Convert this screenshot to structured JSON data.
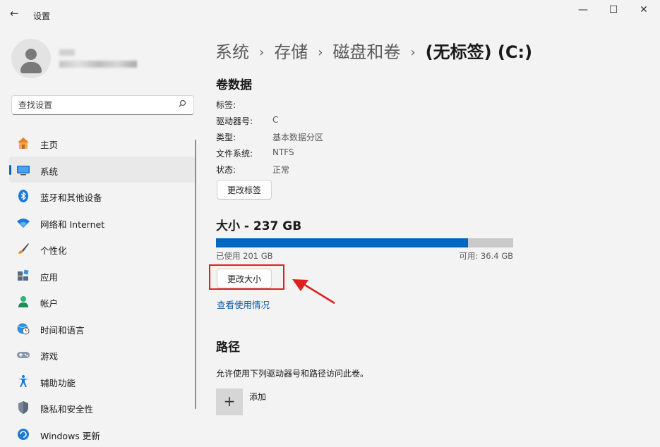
{
  "window": {
    "title": "设置",
    "back_glyph": "←",
    "minimize_glyph": "—",
    "maximize_glyph": "☐",
    "close_glyph": "✕"
  },
  "search": {
    "placeholder": "查找设置",
    "value": "",
    "icon": "search-icon"
  },
  "sidebar": {
    "items": [
      {
        "label": "主页",
        "icon": "home-icon"
      },
      {
        "label": "系统",
        "icon": "system-icon",
        "active": true
      },
      {
        "label": "蓝牙和其他设备",
        "icon": "bluetooth-icon"
      },
      {
        "label": "网络和 Internet",
        "icon": "wifi-icon"
      },
      {
        "label": "个性化",
        "icon": "brush-icon"
      },
      {
        "label": "应用",
        "icon": "apps-icon"
      },
      {
        "label": "帐户",
        "icon": "account-icon"
      },
      {
        "label": "时间和语言",
        "icon": "globe-clock-icon"
      },
      {
        "label": "游戏",
        "icon": "gamepad-icon"
      },
      {
        "label": "辅助功能",
        "icon": "accessibility-icon"
      },
      {
        "label": "隐私和安全性",
        "icon": "shield-icon"
      },
      {
        "label": "Windows 更新",
        "icon": "update-icon"
      }
    ]
  },
  "breadcrumb": {
    "items": [
      "系统",
      "存储",
      "磁盘和卷"
    ],
    "current": "(无标签) (C:)",
    "separator": "›"
  },
  "volume": {
    "heading": "卷数据",
    "properties": [
      {
        "label": "标签:",
        "value": ""
      },
      {
        "label": "驱动器号:",
        "value": "C"
      },
      {
        "label": "类型:",
        "value": "基本数据分区"
      },
      {
        "label": "文件系统:",
        "value": "NTFS"
      },
      {
        "label": "状态:",
        "value": "正常"
      }
    ],
    "change_label_button": "更改标签"
  },
  "size": {
    "heading": "大小 - 237 GB",
    "used_fraction": 0.848,
    "used_text": "已使用 201 GB",
    "free_text": "可用: 36.4 GB",
    "resize_button": "更改大小",
    "usage_link": "查看使用情况"
  },
  "path": {
    "heading": "路径",
    "description": "允许使用下列驱动器号和路径访问此卷。",
    "add_glyph": "+",
    "add_label": "添加"
  },
  "colors": {
    "accent": "#0067c0",
    "highlight_annotation": "#e02020",
    "bar_empty": "#c9c9c9"
  }
}
